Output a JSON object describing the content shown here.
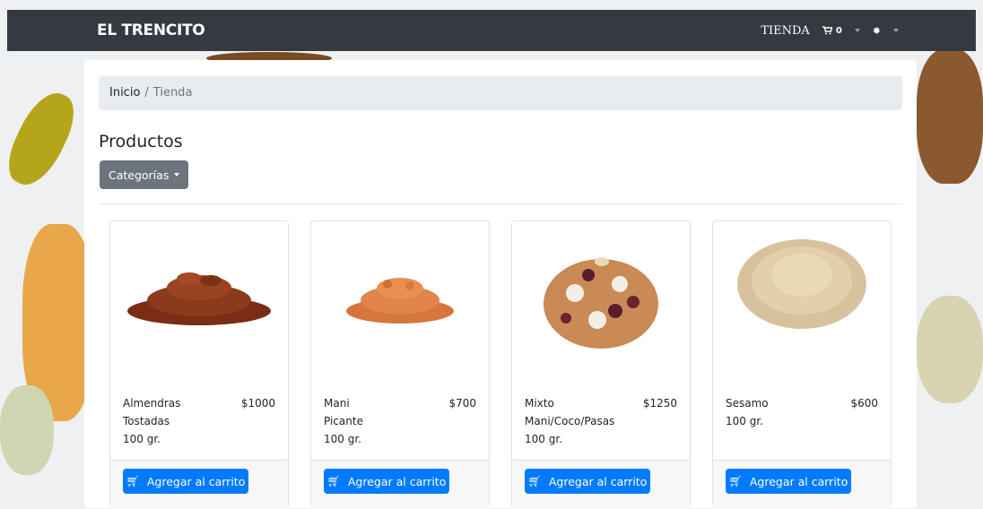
{
  "navbar": {
    "brand": "EL TRENCITO",
    "shop_link": "TIENDA",
    "cart_icon": "cart-icon",
    "cart_count": "0",
    "settings_icon": "gear-icon"
  },
  "breadcrumb": {
    "home": "Inicio",
    "separator": "/",
    "current": "Tienda"
  },
  "page": {
    "title": "Productos",
    "categories_button": "Categorías"
  },
  "products": [
    {
      "name_line1": "Almendras",
      "name_line2": "Tostadas",
      "weight": "100 gr.",
      "price": "$1000",
      "button": "Agregar al carrito",
      "image": "almonds-image"
    },
    {
      "name_line1": "Mani",
      "name_line2": "Picante",
      "weight": "100 gr.",
      "price": "$700",
      "button": "Agregar al carrito",
      "image": "peanuts-image"
    },
    {
      "name_line1": "Mixto",
      "name_line2": "Mani/Coco/Pasas",
      "weight": "100 gr.",
      "price": "$1250",
      "button": "Agregar al carrito",
      "image": "mixed-nuts-image"
    },
    {
      "name_line1": "Sesamo",
      "name_line2": "100 gr.",
      "weight": "",
      "price": "$600",
      "button": "Agregar al carrito",
      "image": "sesame-image"
    }
  ],
  "colors": {
    "navbar": "#343a40",
    "primary": "#007bff",
    "secondary": "#6c757d"
  }
}
